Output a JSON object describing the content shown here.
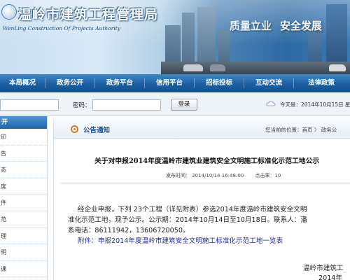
{
  "header": {
    "title": "温岭市建筑工程管理局",
    "subtitle": "WenLing Construction Of Projects Authority",
    "slogan_left": "质量立业",
    "slogan_right": "安全发展"
  },
  "nav": {
    "items": [
      {
        "label": "本局概况"
      },
      {
        "label": "政务公开"
      },
      {
        "label": "政务平台"
      },
      {
        "label": "信用平台"
      },
      {
        "label": "招标投标"
      },
      {
        "label": "互动交流"
      },
      {
        "label": "法律政策"
      }
    ]
  },
  "login": {
    "password_label": "密码：",
    "login_button": "登录",
    "today": "今天是：2014年10月15日 星"
  },
  "sidebar": {
    "header": "开",
    "items": [
      {
        "label": "印"
      },
      {
        "label": "告"
      },
      {
        "label": "态"
      },
      {
        "label": "度"
      },
      {
        "label": "件"
      },
      {
        "label": "范"
      },
      {
        "label": "理"
      },
      {
        "label": "明"
      },
      {
        "label": "课"
      }
    ]
  },
  "main": {
    "section_title": "公告通知",
    "breadcrumb": "您当前的位置：首页 〉 政务公",
    "article": {
      "title": "关于对申报2014年度温岭市建筑业建筑安全文明施工标准化示范工地公示",
      "publish_time": "发布时间： 2014/10/14 16:48:00",
      "hits": "点击率：10",
      "lines": [
        "经企业申报，下列 23个工程（详见附表）参选2014年度温岭市建筑安全文明",
        "准化示范工地，现予公示。公示期：2014年10月14日至10月18日。联系人：潘",
        "系电话：86111942，13606720050。",
        "附件：申报2014年度温岭市建筑安全文明施工标准化示范工地一览表"
      ],
      "signature": "温岭市建筑工",
      "signature_date": "2014年"
    }
  },
  "colors": {
    "nav": "#1b5fa2",
    "title_blue": "#1d4f87",
    "accent_orange": "#d77a1f"
  }
}
